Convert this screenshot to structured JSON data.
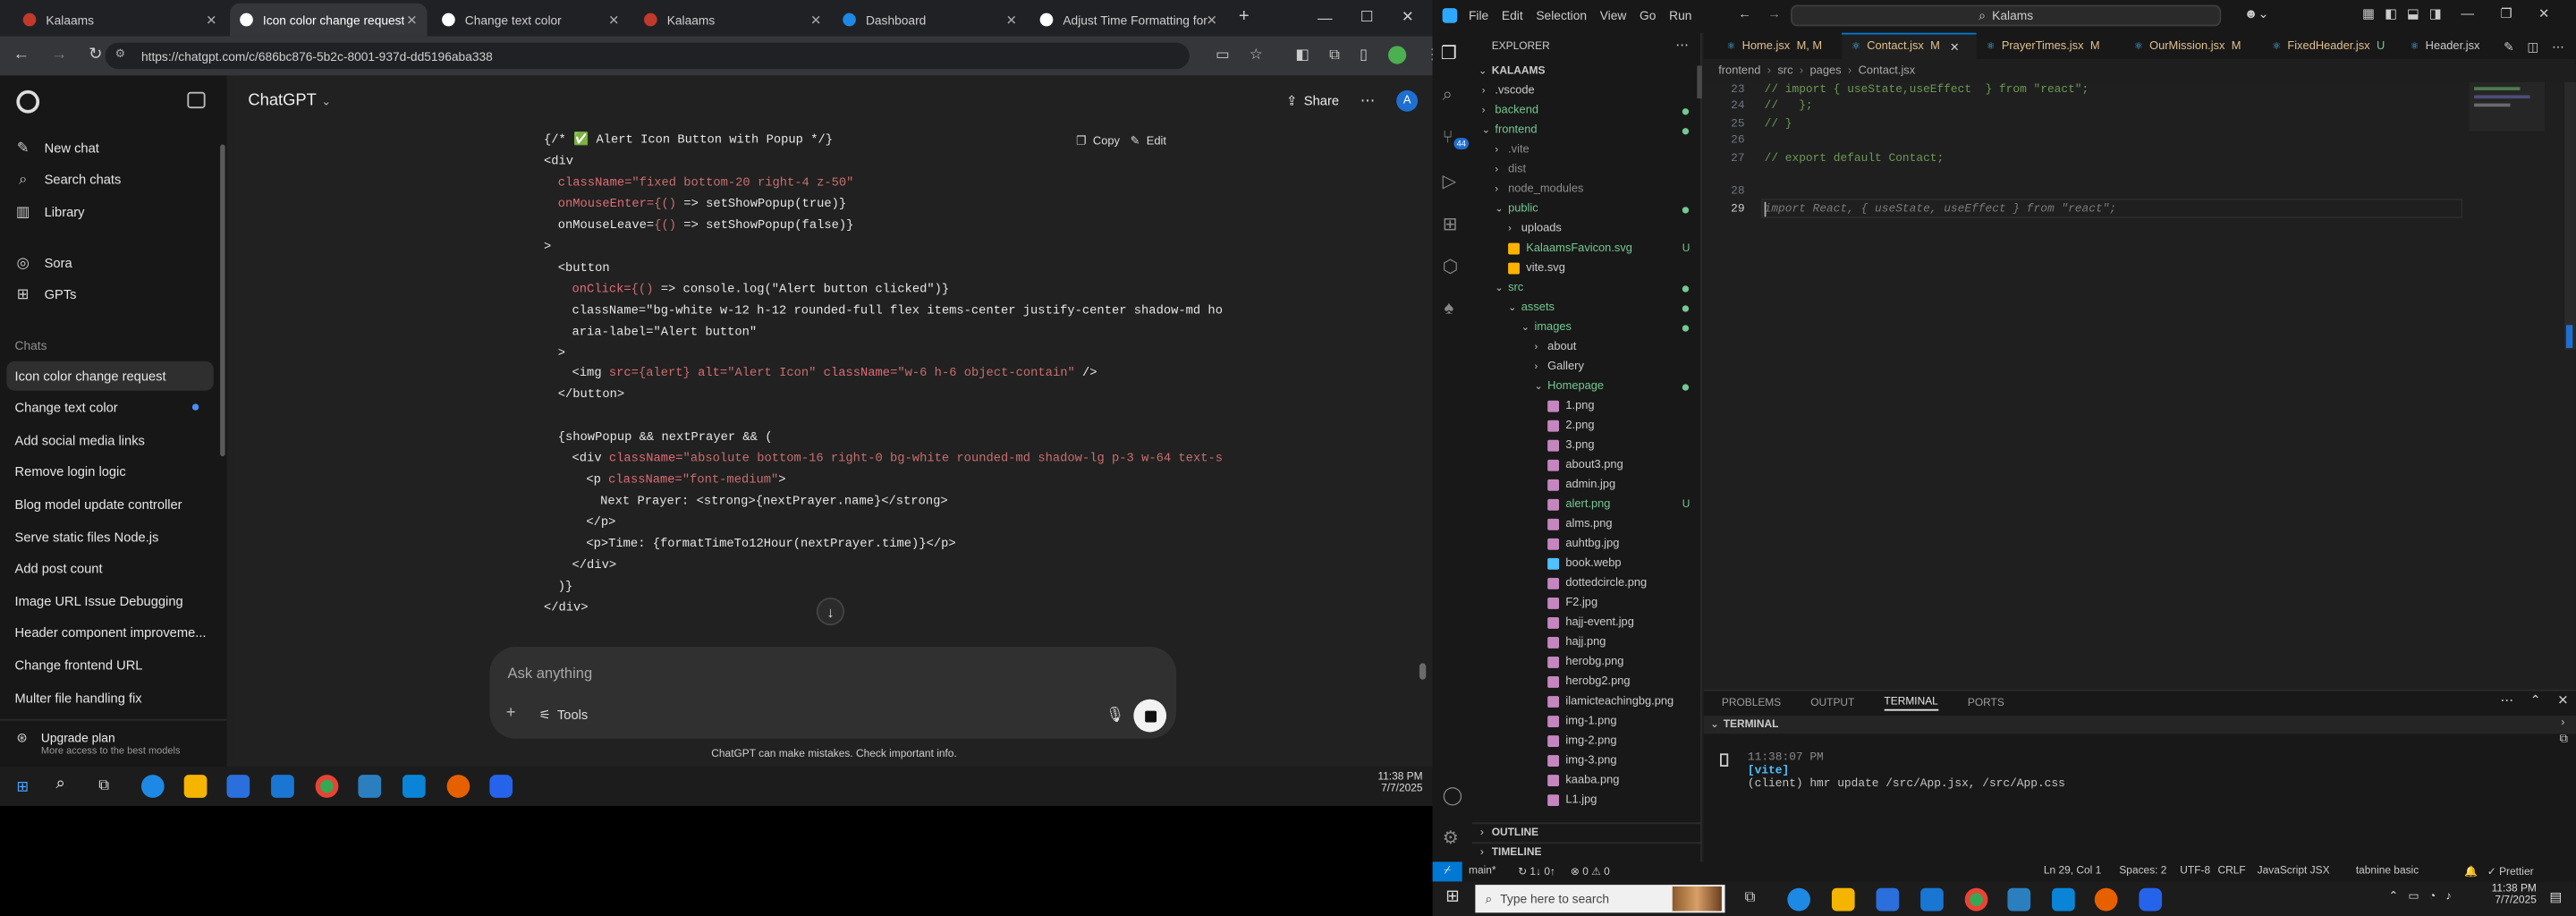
{
  "browser": {
    "tabs": [
      {
        "title": "Kalaams",
        "active": false,
        "color": "#c0392b"
      },
      {
        "title": "Icon color change request",
        "active": true,
        "color": "#ffffff"
      },
      {
        "title": "Change text color",
        "active": false,
        "color": "#ffffff"
      },
      {
        "title": "Kalaams",
        "active": false,
        "color": "#c0392b"
      },
      {
        "title": "Dashboard",
        "active": false,
        "color": "#1e88e5"
      },
      {
        "title": "Adjust Time Formatting for",
        "active": false,
        "color": "#ffffff"
      }
    ],
    "new_tab": "+",
    "url": "https://chatgpt.com/c/686bc876-5b2c-8001-937d-dd5196aba338"
  },
  "chatgpt": {
    "model": "ChatGPT",
    "share": "Share",
    "avatar": "A",
    "nav": [
      {
        "label": "New chat",
        "icon": "edit-icon"
      },
      {
        "label": "Search chats",
        "icon": "search-icon"
      },
      {
        "label": "Library",
        "icon": "library-icon"
      },
      {
        "label": "Sora",
        "icon": "sora-icon"
      },
      {
        "label": "GPTs",
        "icon": "grid-icon"
      }
    ],
    "chats_heading": "Chats",
    "chats": [
      "Icon color change request",
      "Change text color",
      "Add social media links",
      "Remove login logic",
      "Blog model update controller",
      "Serve static files Node.js",
      "Add post count",
      "Image URL Issue Debugging",
      "Header component improveme...",
      "Change frontend URL",
      "Multer file handling fix"
    ],
    "upgrade_title": "Upgrade plan",
    "upgrade_sub": "More access to the best models",
    "copy": "Copy",
    "edit": "Edit",
    "composer_placeholder": "Ask anything",
    "tools": "Tools",
    "disclaimer": "ChatGPT can make mistakes. Check important info.",
    "code": [
      {
        "indent": 0,
        "parts": [
          [
            "p",
            "{/* "
          ],
          [
            "g",
            "✅"
          ],
          [
            "p",
            " Alert Icon Button with Popup */}"
          ]
        ]
      },
      {
        "indent": 0,
        "parts": [
          [
            "p",
            "<div"
          ]
        ]
      },
      {
        "indent": 1,
        "parts": [
          [
            "a",
            "className="
          ],
          [
            "s",
            "\"fixed bottom-20 right-4 z-50\""
          ]
        ]
      },
      {
        "indent": 1,
        "parts": [
          [
            "a",
            "onMouseEnter="
          ],
          [
            "s",
            "{() "
          ],
          [
            "p",
            "=> setShowPopup(true)}"
          ]
        ]
      },
      {
        "indent": 1,
        "parts": [
          [
            "p",
            "onMouseLeave="
          ],
          [
            "s",
            "{() "
          ],
          [
            "p",
            "=> setShowPopup(false)}"
          ]
        ]
      },
      {
        "indent": 0,
        "parts": [
          [
            "p",
            ">"
          ]
        ]
      },
      {
        "indent": 1,
        "parts": [
          [
            "p",
            "<button"
          ]
        ]
      },
      {
        "indent": 2,
        "parts": [
          [
            "a",
            "onClick="
          ],
          [
            "s",
            "{() "
          ],
          [
            "p",
            "=> console.log(\"Alert button clicked\")}"
          ]
        ]
      },
      {
        "indent": 2,
        "parts": [
          [
            "p",
            "className=\"bg-white w-12 h-12 rounded-full flex items-center justify-center shadow-md ho"
          ]
        ]
      },
      {
        "indent": 2,
        "parts": [
          [
            "p",
            "aria-label=\"Alert button\""
          ]
        ]
      },
      {
        "indent": 1,
        "parts": [
          [
            "p",
            ">"
          ]
        ]
      },
      {
        "indent": 2,
        "parts": [
          [
            "p",
            "<img "
          ],
          [
            "a",
            "src="
          ],
          [
            "s",
            "{alert} "
          ],
          [
            "a",
            "alt="
          ],
          [
            "s",
            "\"Alert Icon\" "
          ],
          [
            "a",
            "className="
          ],
          [
            "s",
            "\"w-6 h-6 object-contain\""
          ],
          [
            "p",
            " />"
          ]
        ]
      },
      {
        "indent": 1,
        "parts": [
          [
            "p",
            "</button>"
          ]
        ]
      },
      {
        "indent": 0,
        "parts": [
          [
            "p",
            ""
          ]
        ]
      },
      {
        "indent": 1,
        "parts": [
          [
            "p",
            "{showPopup && nextPrayer && ("
          ]
        ]
      },
      {
        "indent": 2,
        "parts": [
          [
            "p",
            "<div "
          ],
          [
            "a",
            "className="
          ],
          [
            "s",
            "\"absolute bottom-16 right-0 bg-white rounded-md shadow-lg p-3 w-64 text-s"
          ]
        ]
      },
      {
        "indent": 3,
        "parts": [
          [
            "p",
            "<p "
          ],
          [
            "a",
            "className="
          ],
          [
            "s",
            "\"font-medium\""
          ],
          [
            "p",
            ">"
          ]
        ]
      },
      {
        "indent": 4,
        "parts": [
          [
            "p",
            "Next Prayer: <strong>{nextPrayer.name}</strong>"
          ]
        ]
      },
      {
        "indent": 3,
        "parts": [
          [
            "p",
            "</p>"
          ]
        ]
      },
      {
        "indent": 3,
        "parts": [
          [
            "p",
            "<p>Time: {formatTimeTo12Hour(nextPrayer.time)}</p>"
          ]
        ]
      },
      {
        "indent": 2,
        "parts": [
          [
            "p",
            "</div>"
          ]
        ]
      },
      {
        "indent": 1,
        "parts": [
          [
            "p",
            ")}"
          ]
        ]
      },
      {
        "indent": 0,
        "parts": [
          [
            "p",
            "</div>"
          ]
        ]
      }
    ]
  },
  "vscode": {
    "menu": [
      "File",
      "Edit",
      "Selection",
      "View",
      "Go",
      "Run"
    ],
    "search": "Kalams",
    "explorer_title": "EXPLORER",
    "project": "KALAAMS",
    "tree": [
      {
        "label": ".vscode",
        "depth": 1,
        "kind": "folder",
        "open": false,
        "badge": ""
      },
      {
        "label": "backend",
        "depth": 1,
        "kind": "folder",
        "open": false,
        "badge": "dot"
      },
      {
        "label": "frontend",
        "depth": 1,
        "kind": "folder",
        "open": true,
        "badge": "dot"
      },
      {
        "label": ".vite",
        "depth": 2,
        "kind": "folder",
        "open": false,
        "badge": ""
      },
      {
        "label": "dist",
        "depth": 2,
        "kind": "folder",
        "open": false,
        "badge": ""
      },
      {
        "label": "node_modules",
        "depth": 2,
        "kind": "folder",
        "open": false,
        "badge": ""
      },
      {
        "label": "public",
        "depth": 2,
        "kind": "folder",
        "open": true,
        "badge": "dot"
      },
      {
        "label": "uploads",
        "depth": 3,
        "kind": "folder",
        "open": false,
        "badge": ""
      },
      {
        "label": "KalaamsFavicon.svg",
        "depth": 3,
        "kind": "svg",
        "open": false,
        "badge": "U"
      },
      {
        "label": "vite.svg",
        "depth": 3,
        "kind": "svg",
        "open": false,
        "badge": ""
      },
      {
        "label": "src",
        "depth": 2,
        "kind": "folder",
        "open": true,
        "badge": "dot"
      },
      {
        "label": "assets",
        "depth": 3,
        "kind": "folder",
        "open": true,
        "badge": "dot"
      },
      {
        "label": "images",
        "depth": 4,
        "kind": "folder",
        "open": true,
        "badge": "dot"
      },
      {
        "label": "about",
        "depth": 5,
        "kind": "folder",
        "open": false,
        "badge": ""
      },
      {
        "label": "Gallery",
        "depth": 5,
        "kind": "folder",
        "open": false,
        "badge": ""
      },
      {
        "label": "Homepage",
        "depth": 5,
        "kind": "folder",
        "open": true,
        "badge": "dot"
      },
      {
        "label": "1.png",
        "depth": 6,
        "kind": "img",
        "open": false,
        "badge": ""
      },
      {
        "label": "2.png",
        "depth": 6,
        "kind": "img",
        "open": false,
        "badge": ""
      },
      {
        "label": "3.png",
        "depth": 6,
        "kind": "img",
        "open": false,
        "badge": ""
      },
      {
        "label": "about3.png",
        "depth": 6,
        "kind": "img",
        "open": false,
        "badge": ""
      },
      {
        "label": "admin.jpg",
        "depth": 6,
        "kind": "img",
        "open": false,
        "badge": ""
      },
      {
        "label": "alert.png",
        "depth": 6,
        "kind": "img-new",
        "open": false,
        "badge": "U"
      },
      {
        "label": "alms.png",
        "depth": 6,
        "kind": "img",
        "open": false,
        "badge": ""
      },
      {
        "label": "auhtbg.jpg",
        "depth": 6,
        "kind": "img",
        "open": false,
        "badge": ""
      },
      {
        "label": "book.webp",
        "depth": 6,
        "kind": "webp",
        "open": false,
        "badge": ""
      },
      {
        "label": "dottedcircle.png",
        "depth": 6,
        "kind": "img",
        "open": false,
        "badge": ""
      },
      {
        "label": "F2.jpg",
        "depth": 6,
        "kind": "img",
        "open": false,
        "badge": ""
      },
      {
        "label": "hajj-event.jpg",
        "depth": 6,
        "kind": "img",
        "open": false,
        "badge": ""
      },
      {
        "label": "hajj.png",
        "depth": 6,
        "kind": "img",
        "open": false,
        "badge": ""
      },
      {
        "label": "herobg.png",
        "depth": 6,
        "kind": "img",
        "open": false,
        "badge": ""
      },
      {
        "label": "herobg2.png",
        "depth": 6,
        "kind": "img",
        "open": false,
        "badge": ""
      },
      {
        "label": "ilamicteachingbg.png",
        "depth": 6,
        "kind": "img",
        "open": false,
        "badge": ""
      },
      {
        "label": "img-1.png",
        "depth": 6,
        "kind": "img",
        "open": false,
        "badge": ""
      },
      {
        "label": "img-2.png",
        "depth": 6,
        "kind": "img",
        "open": false,
        "badge": ""
      },
      {
        "label": "img-3.png",
        "depth": 6,
        "kind": "img",
        "open": false,
        "badge": ""
      },
      {
        "label": "kaaba.png",
        "depth": 6,
        "kind": "img",
        "open": false,
        "badge": ""
      },
      {
        "label": "L1.jpg",
        "depth": 6,
        "kind": "img",
        "open": false,
        "badge": ""
      }
    ],
    "outline": "OUTLINE",
    "timeline": "TIMELINE",
    "tabs": [
      {
        "label": "Home.jsx",
        "mod": "M, M",
        "active": false
      },
      {
        "label": "Contact.jsx",
        "mod": "M",
        "active": true
      },
      {
        "label": "PrayerTimes.jsx",
        "mod": "M",
        "active": false
      },
      {
        "label": "OurMission.jsx",
        "mod": "M",
        "active": false
      },
      {
        "label": "FixedHeader.jsx",
        "mod": "U",
        "active": false
      },
      {
        "label": "Header.jsx",
        "mod": "",
        "active": false
      }
    ],
    "breadcrumb": [
      "frontend",
      "src",
      "pages",
      "Contact.jsx"
    ],
    "editor_lines": [
      {
        "n": "23",
        "text": "// import { useState,useEffect  } from \"react\";",
        "cls": "comment"
      },
      {
        "n": "24",
        "text": "//   };",
        "cls": "comment"
      },
      {
        "n": "25",
        "text": "// }",
        "cls": "comment"
      },
      {
        "n": "26",
        "text": "",
        "cls": "comment"
      },
      {
        "n": "27",
        "text": "// export default Contact;",
        "cls": "comment"
      },
      {
        "n": "28",
        "text": "",
        "cls": "comment"
      },
      {
        "n": "29",
        "text": "import React, { useState, useEffect } from \"react\";",
        "cls": "ghost"
      }
    ],
    "panel_tabs": [
      "PROBLEMS",
      "OUTPUT",
      "TERMINAL",
      "PORTS"
    ],
    "panel_active": "TERMINAL",
    "terminal_title": "TERMINAL",
    "terminal_time": "11:38:07 PM",
    "terminal_vite": "[vite]",
    "terminal_msg": "(client) hmr update /src/App.jsx, /src/App.css",
    "status": {
      "branch": "main*",
      "sync": "↻ 1↓ 0↑",
      "problems": "⊗ 0 ⚠ 0",
      "position": "Ln 29, Col 1",
      "spaces": "Spaces: 2",
      "encoding": "UTF-8",
      "eol": "CRLF",
      "language": "JavaScript JSX",
      "tabnine": "tabnine basic",
      "prettier": "✓ Prettier"
    }
  },
  "taskbar": {
    "time": "11:38 PM",
    "date": "7/7/2025",
    "search_placeholder": "Type here to search"
  }
}
